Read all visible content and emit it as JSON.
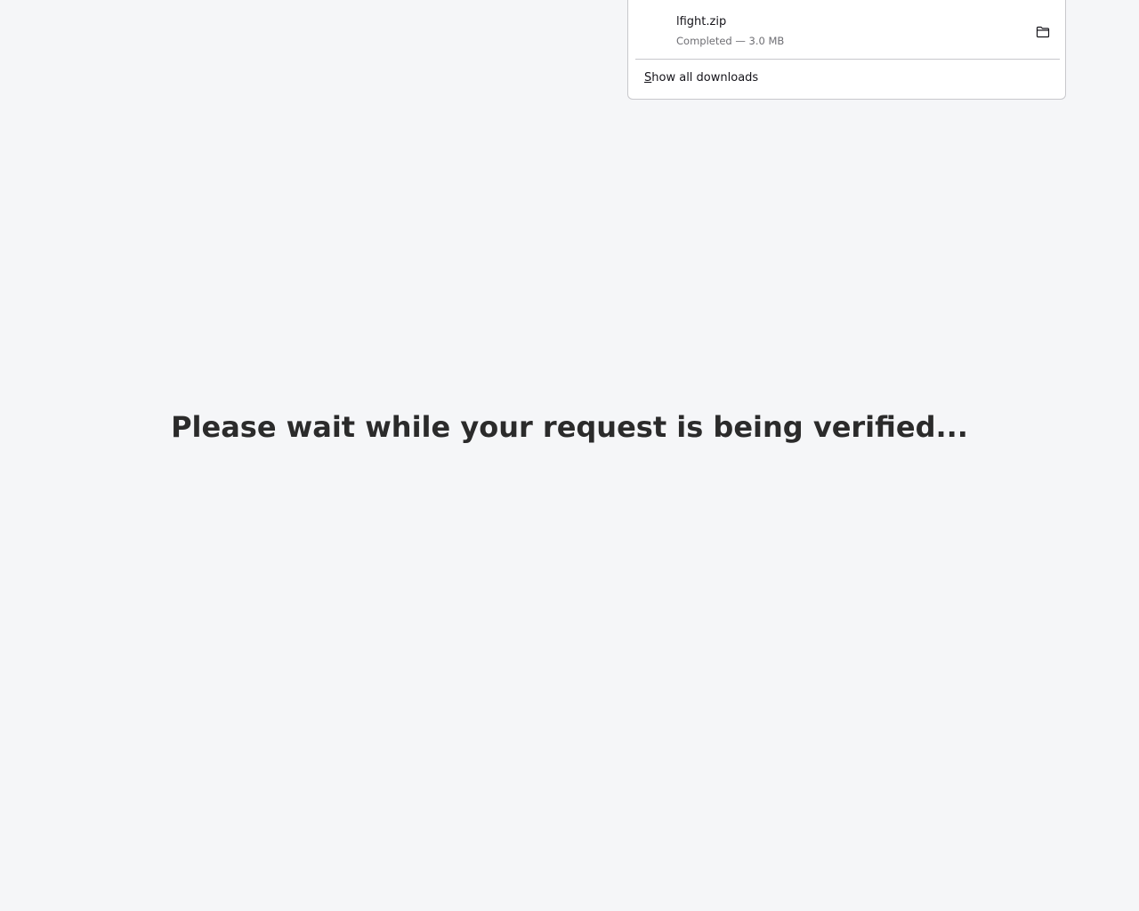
{
  "main": {
    "heading": "Please wait while your request is being verified..."
  },
  "downloads_panel": {
    "items": [
      {
        "file_name": "lfight.zip",
        "status": "Completed — 3.0 MB",
        "icon": "zip-file-icon",
        "action_icon": "folder-icon"
      }
    ],
    "show_all": {
      "access_key": "S",
      "rest": "how all downloads"
    }
  },
  "colors": {
    "background": "#f5f6f8",
    "heading": "#2b2b2b",
    "panel_border": "#c8c8cc",
    "secondary_text": "#6e6e73"
  }
}
